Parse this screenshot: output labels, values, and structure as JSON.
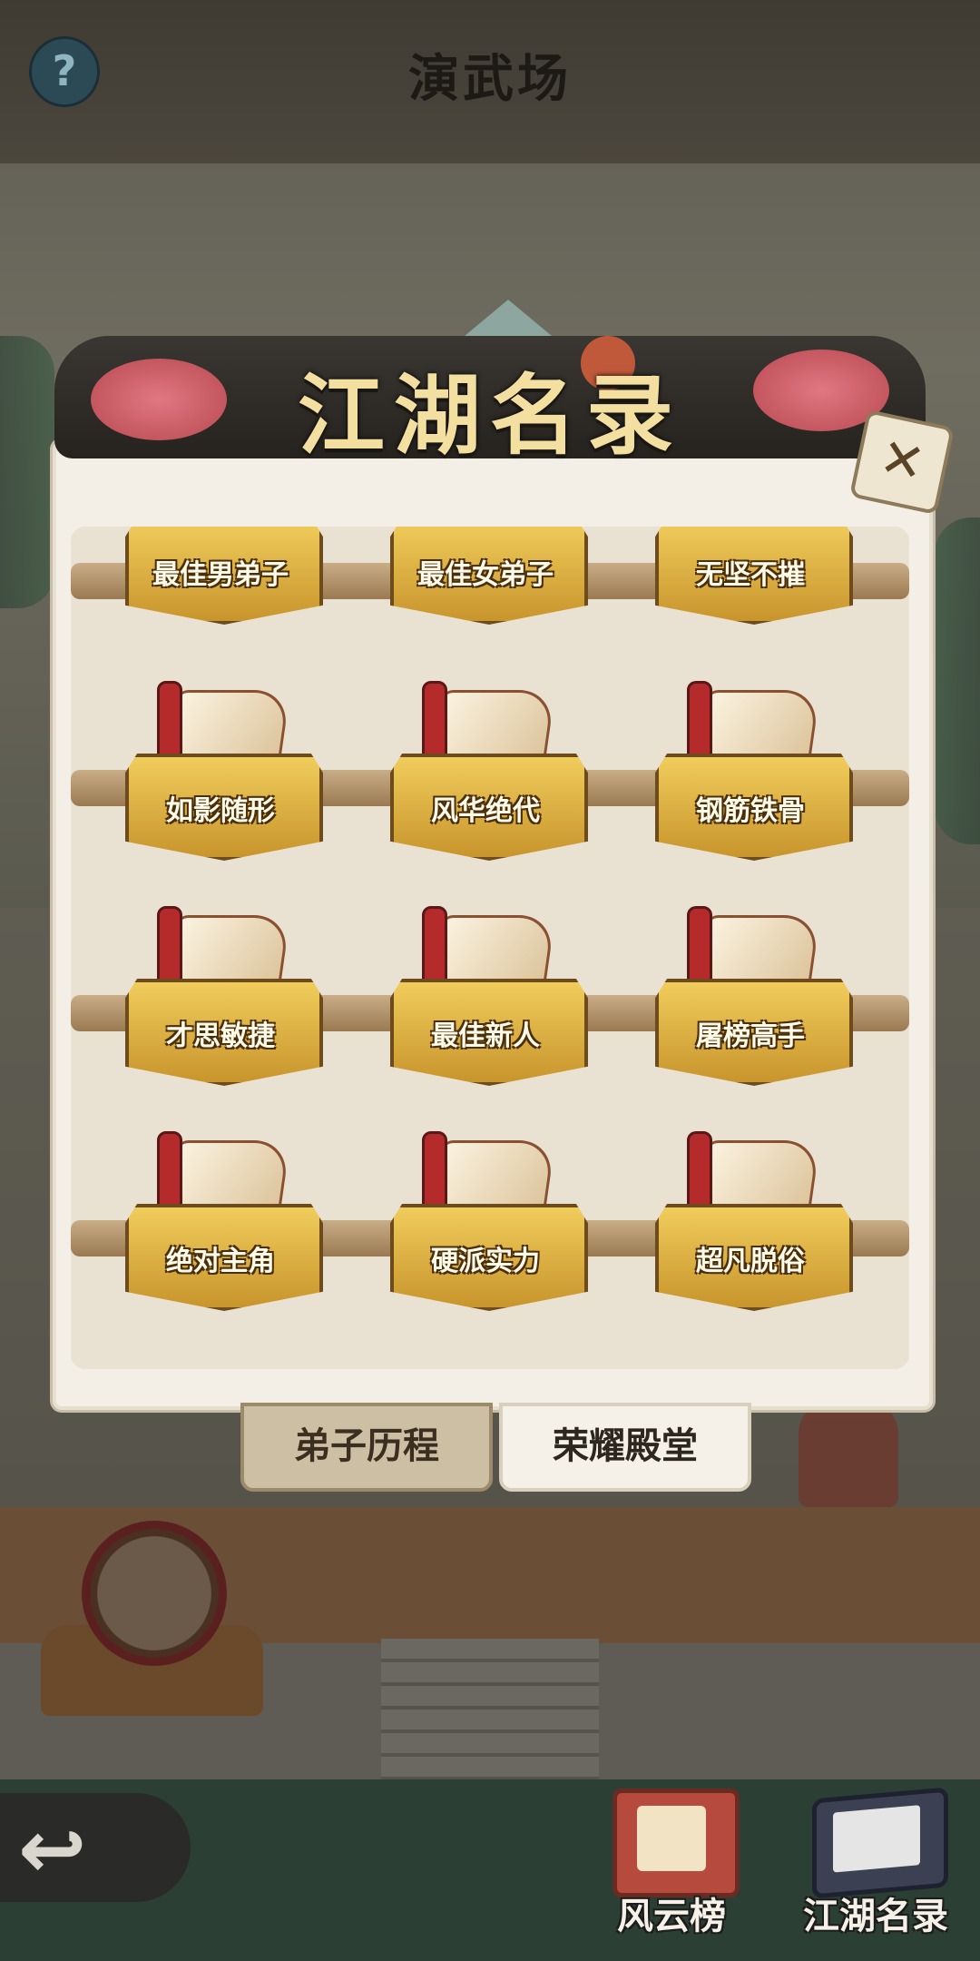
{
  "header": {
    "help_label": "?",
    "title": "演武场"
  },
  "panel": {
    "title": "江湖名录",
    "close_label": "✕",
    "items": [
      {
        "label": "最佳男弟子"
      },
      {
        "label": "最佳女弟子"
      },
      {
        "label": "无坚不摧"
      },
      {
        "label": "如影随形"
      },
      {
        "label": "风华绝代"
      },
      {
        "label": "钢筋铁骨"
      },
      {
        "label": "才思敏捷"
      },
      {
        "label": "最佳新人"
      },
      {
        "label": "屠榜高手"
      },
      {
        "label": "绝对主角"
      },
      {
        "label": "硬派实力"
      },
      {
        "label": "超凡脱俗"
      }
    ]
  },
  "tabs": [
    {
      "label": "弟子历程",
      "selected": false
    },
    {
      "label": "荣耀殿堂",
      "selected": true
    }
  ],
  "bottom_nav": {
    "back_icon": "back-arrow-icon",
    "fengyun_label": "风云榜",
    "jianghu_label": "江湖名录"
  },
  "colors": {
    "plaque_gold": "#e3b645",
    "panel_bg": "#f3efe6",
    "accent_red": "#b52a2a"
  }
}
